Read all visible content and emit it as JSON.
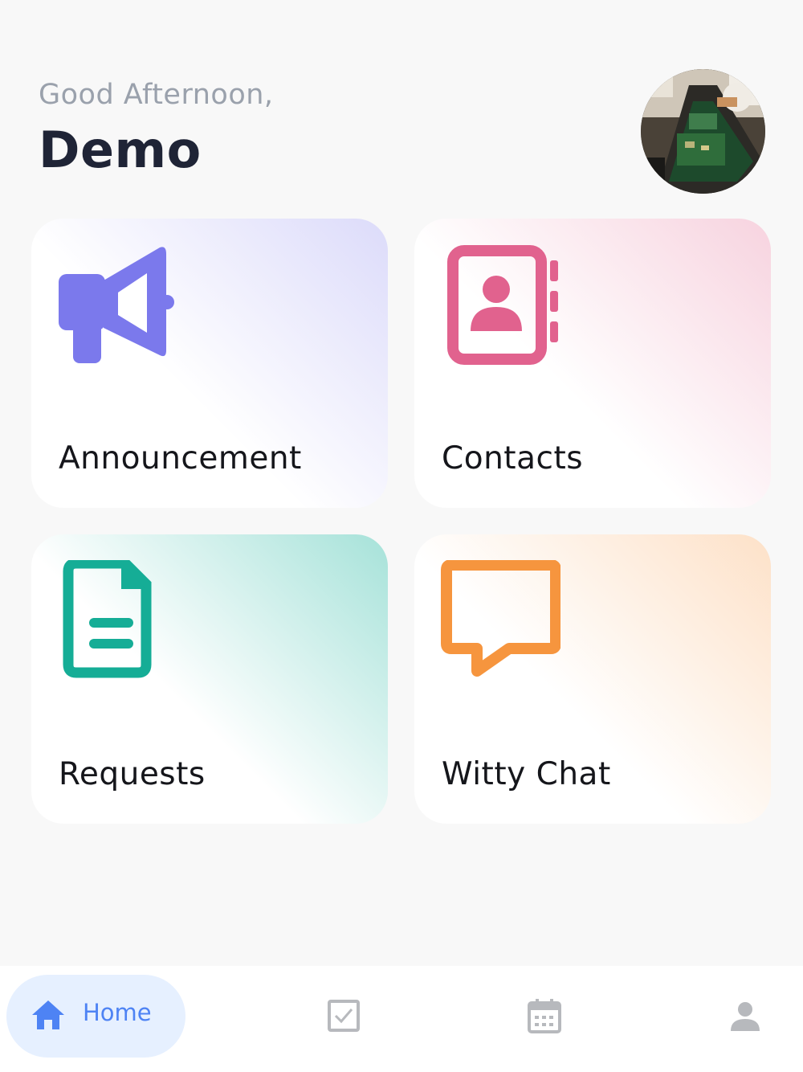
{
  "header": {
    "greeting": "Good Afternoon,",
    "username": "Demo"
  },
  "cards": [
    {
      "label": "Announcement",
      "icon": "megaphone-icon",
      "color": "#7b79ec",
      "gradient_color": "#dcdbfa"
    },
    {
      "label": "Contacts",
      "icon": "contact-book-icon",
      "color": "#e1628e",
      "gradient_color": "#f7d3df"
    },
    {
      "label": "Requests",
      "icon": "document-icon",
      "color": "#15ad96",
      "gradient_color": "#a6e2d9"
    },
    {
      "label": "Witty Chat",
      "icon": "chat-bubble-icon",
      "color": "#f6953e",
      "gradient_color": "#fde1c8"
    }
  ],
  "nav": {
    "home_label": "Home",
    "active_color": "#4e83f4",
    "inactive_color": "#b7b9bd",
    "items": [
      "home-icon",
      "tasks-checkbox-icon",
      "calendar-icon",
      "profile-icon"
    ]
  }
}
